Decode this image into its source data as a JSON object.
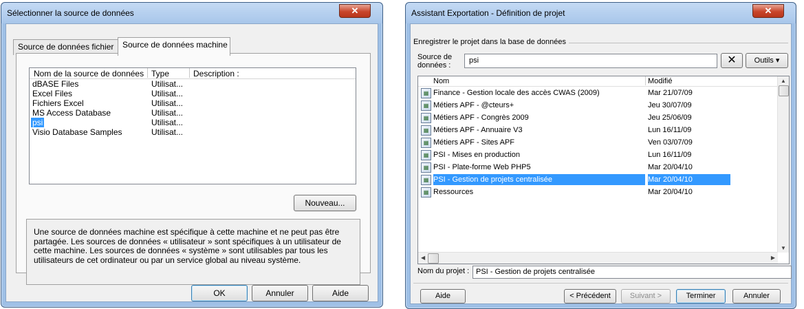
{
  "left_dialog": {
    "title": "Sélectionner la source de données",
    "tabs": [
      {
        "label": "Source de données fichier"
      },
      {
        "label": "Source de données machine"
      }
    ],
    "columns": [
      "Nom de la source de données",
      "Type",
      "Description :"
    ],
    "rows": [
      {
        "name": "dBASE Files",
        "type": "Utilisat...",
        "selected": false
      },
      {
        "name": "Excel Files",
        "type": "Utilisat...",
        "selected": false
      },
      {
        "name": "Fichiers Excel",
        "type": "Utilisat...",
        "selected": false
      },
      {
        "name": "MS Access Database",
        "type": "Utilisat...",
        "selected": false
      },
      {
        "name": "psi",
        "type": "Utilisat...",
        "selected": true
      },
      {
        "name": "Visio Database Samples",
        "type": "Utilisat...",
        "selected": false
      }
    ],
    "new_button": "Nouveau...",
    "description": "Une source de données machine est spécifique à cette machine et ne peut pas être partagée. Les sources de données « utilisateur » sont spécifiques à un utilisateur de cette machine. Les sources de données « système » sont utilisables par tous les utilisateurs de cet ordinateur ou par un service global au niveau système.",
    "buttons": {
      "ok": "OK",
      "cancel": "Annuler",
      "help": "Aide"
    }
  },
  "right_dialog": {
    "title": "Assistant Exportation - Définition de projet",
    "group_label": "Enregistrer le projet dans la base de données",
    "source_label": "Source de données :",
    "source_value": "psi",
    "tools_button": "Outils ▾",
    "columns": [
      "Nom",
      "Modifié"
    ],
    "rows": [
      {
        "name": "Finance - Gestion locale des accès CWAS (2009)",
        "modified": "Mar 21/07/09",
        "selected": false
      },
      {
        "name": "Métiers APF - @cteurs+",
        "modified": "Jeu 30/07/09",
        "selected": false
      },
      {
        "name": "Métiers APF - Congrès 2009",
        "modified": "Jeu 25/06/09",
        "selected": false
      },
      {
        "name": "Métiers APF - Annuaire V3",
        "modified": "Lun 16/11/09",
        "selected": false
      },
      {
        "name": "Métiers APF - Sites APF",
        "modified": "Ven 03/07/09",
        "selected": false
      },
      {
        "name": "PSI - Mises en production",
        "modified": "Lun 16/11/09",
        "selected": false
      },
      {
        "name": "PSI - Plate-forme Web PHP5",
        "modified": "Mar 20/04/10",
        "selected": false
      },
      {
        "name": "PSI - Gestion de projets centralisée",
        "modified": "Mar 20/04/10",
        "selected": true
      },
      {
        "name": "Ressources",
        "modified": "Mar 20/04/10",
        "selected": false
      }
    ],
    "project_label": "Nom du projet :",
    "project_value": "PSI - Gestion de projets centralisée",
    "buttons": {
      "help": "Aide",
      "previous": "< Précédent",
      "next": "Suivant >",
      "finish": "Terminer",
      "cancel": "Annuler"
    }
  }
}
